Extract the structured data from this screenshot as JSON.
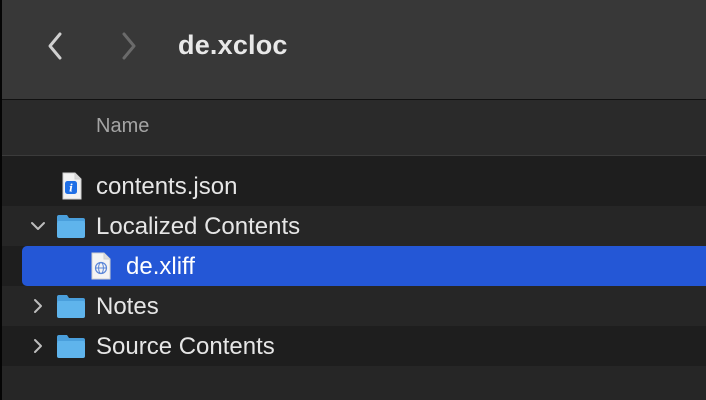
{
  "window": {
    "title": "de.xcloc"
  },
  "toolbar": {
    "back_icon": "chevron-left",
    "forward_icon": "chevron-right"
  },
  "list": {
    "column_header": "Name",
    "rows": [
      {
        "label": "contents.json",
        "icon": "json-file",
        "expanded": null,
        "selected": false
      },
      {
        "label": "Localized Contents",
        "icon": "folder",
        "expanded": true,
        "selected": false
      },
      {
        "label": "de.xliff",
        "icon": "xliff-file",
        "expanded": null,
        "selected": true
      },
      {
        "label": "Notes",
        "icon": "folder",
        "expanded": false,
        "selected": false
      },
      {
        "label": "Source Contents",
        "icon": "folder",
        "expanded": false,
        "selected": false
      }
    ]
  },
  "colors": {
    "selection": "#2457d6",
    "folder": "#5fb4ec",
    "toolbar": "#383838"
  }
}
